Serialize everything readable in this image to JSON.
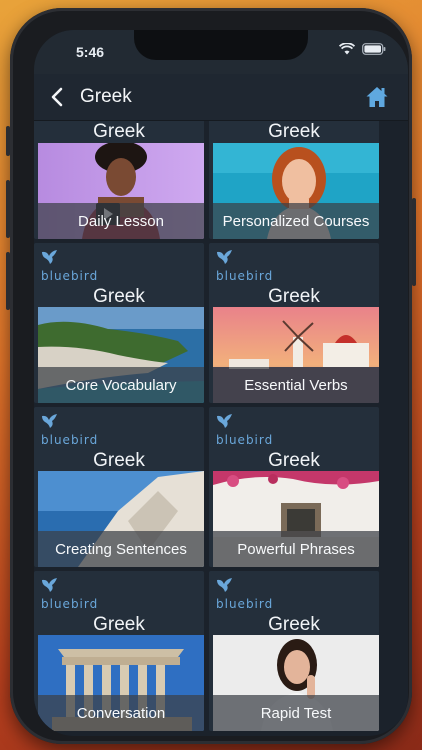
{
  "status_bar": {
    "time": "5:46"
  },
  "header": {
    "title": "Greek"
  },
  "icons": {
    "back": "chevron-left-icon",
    "home": "home-icon"
  },
  "brand": {
    "logo_text": "bluebird"
  },
  "colors": {
    "accent": "#5fa0d6",
    "card_bg": "#242f3b",
    "screen_bg": "#1b222b"
  },
  "cards": [
    {
      "language": "Greek",
      "label": "Daily Lesson"
    },
    {
      "language": "Greek",
      "label": "Personalized Courses"
    },
    {
      "language": "Greek",
      "label": "Core Vocabulary"
    },
    {
      "language": "Greek",
      "label": "Essential Verbs"
    },
    {
      "language": "Greek",
      "label": "Creating Sentences"
    },
    {
      "language": "Greek",
      "label": "Powerful Phrases"
    },
    {
      "language": "Greek",
      "label": "Conversation"
    },
    {
      "language": "Greek",
      "label": "Rapid Test"
    }
  ]
}
